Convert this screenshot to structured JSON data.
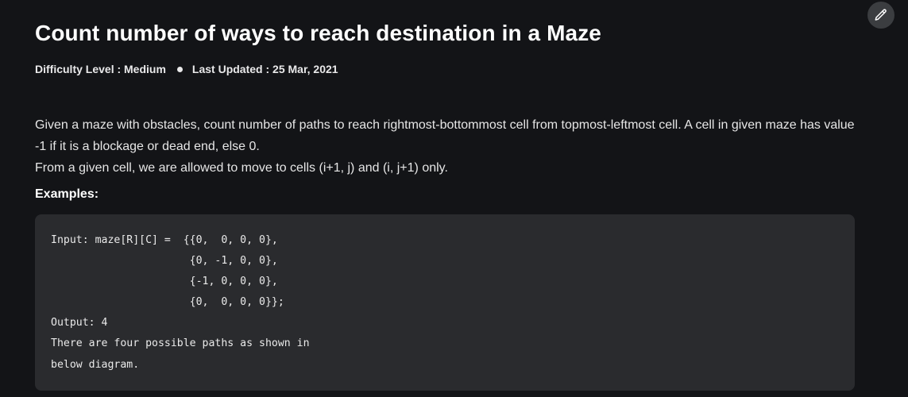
{
  "article": {
    "title": "Count number of ways to reach destination in a Maze",
    "difficulty": "Difficulty Level : Medium",
    "last_updated": "Last Updated : 25 Mar, 2021",
    "description_line1": "Given a maze with obstacles, count number of paths to reach rightmost-bottommost cell from topmost-leftmost cell. A cell in given maze has value -1 if it is a blockage or dead end, else 0.",
    "description_line2": "From a given cell, we are allowed to move to cells (i+1, j) and (i, j+1) only.",
    "examples_heading": "Examples:",
    "code_example": "Input: maze[R][C] =  {{0,  0, 0, 0},\n                      {0, -1, 0, 0},\n                      {-1, 0, 0, 0},\n                      {0,  0, 0, 0}};\nOutput: 4\nThere are four possible paths as shown in\nbelow diagram."
  },
  "toolbar": {
    "edit_icon": "pencil-icon"
  }
}
